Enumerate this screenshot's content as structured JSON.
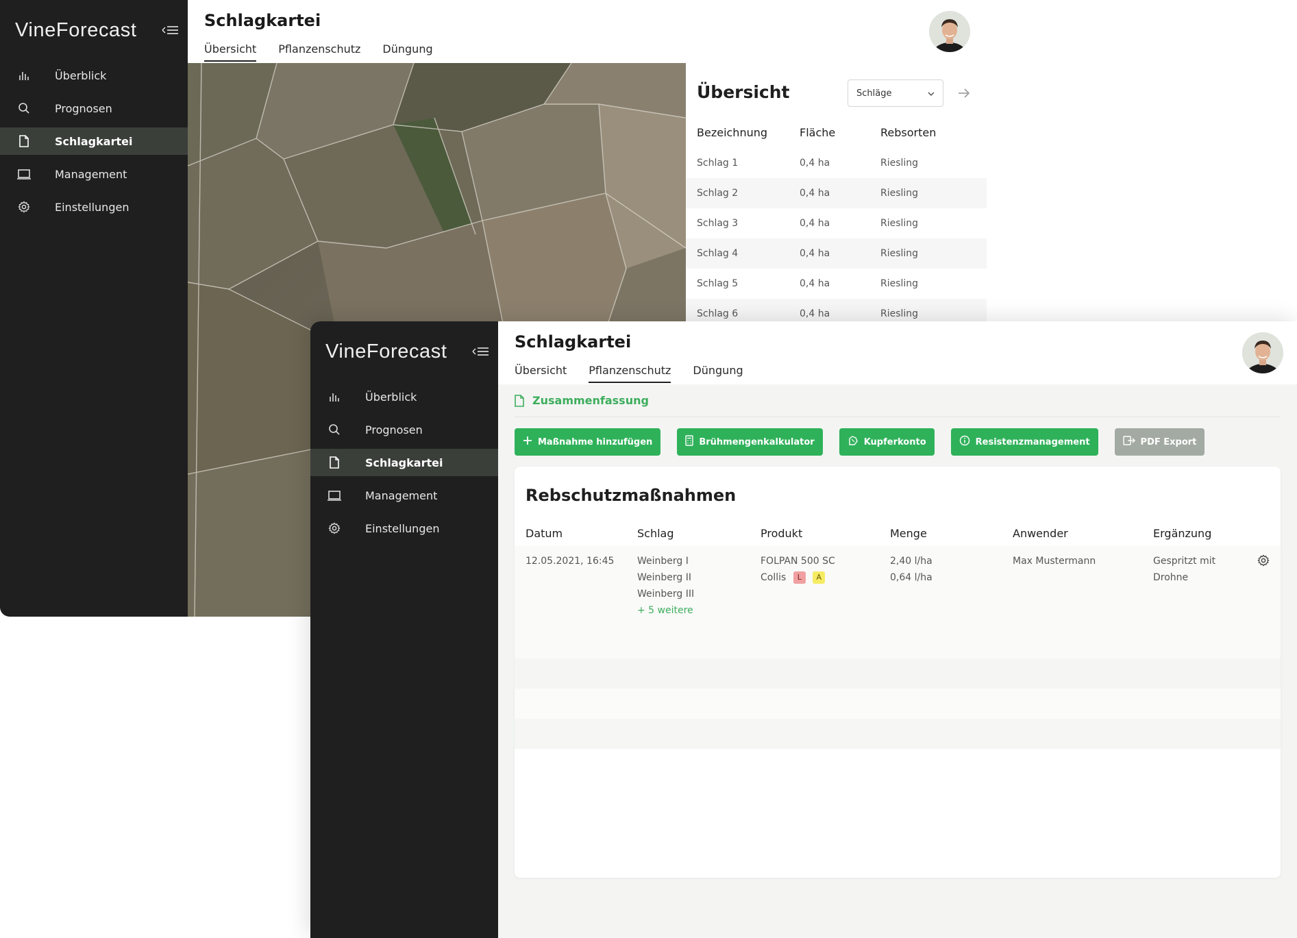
{
  "brand": {
    "name": "VineForecast"
  },
  "colors": {
    "sidebar": "#1f1f1f",
    "accent": "#2fb15a",
    "active_nav": "#3b3f3a",
    "chip_l": "#f0a0a0",
    "chip_a": "#f6ec64"
  },
  "nav": [
    {
      "label": "Überblick",
      "icon": "bar-chart-icon"
    },
    {
      "label": "Prognosen",
      "icon": "search-icon"
    },
    {
      "label": "Schlagkartei",
      "icon": "document-icon",
      "active": true
    },
    {
      "label": "Management",
      "icon": "laptop-icon"
    },
    {
      "label": "Einstellungen",
      "icon": "gear-icon"
    }
  ],
  "page": {
    "title": "Schlagkartei"
  },
  "tabs": [
    "Übersicht",
    "Pflanzenschutz",
    "Düngung"
  ],
  "back_window": {
    "active_tab": "Übersicht",
    "panel": {
      "title": "Übersicht",
      "select_value": "Schläge",
      "columns": [
        "Bezeichnung",
        "Fläche",
        "Rebsorten"
      ],
      "rows": [
        [
          "Schlag 1",
          "0,4 ha",
          "Riesling"
        ],
        [
          "Schlag 2",
          "0,4 ha",
          "Riesling"
        ],
        [
          "Schlag 3",
          "0,4 ha",
          "Riesling"
        ],
        [
          "Schlag 4",
          "0,4 ha",
          "Riesling"
        ],
        [
          "Schlag 5",
          "0,4 ha",
          "Riesling"
        ],
        [
          "Schlag 6",
          "0,4 ha",
          "Riesling"
        ]
      ]
    }
  },
  "front_window": {
    "active_tab": "Pflanzenschutz",
    "summary_label": "Zusammenfassung",
    "actions": [
      {
        "label": "Maßnahme hinzufügen",
        "icon": "plus-icon"
      },
      {
        "label": "Brühmengenkalkulator",
        "icon": "calculator-icon"
      },
      {
        "label": "Kupferkonto",
        "icon": "copper-icon"
      },
      {
        "label": "Resistenzmanagement",
        "icon": "info-icon"
      },
      {
        "label": "PDF Export",
        "icon": "export-icon",
        "disabled": true
      }
    ],
    "card": {
      "title": "Rebschutzmaßnahmen",
      "columns": [
        "Datum",
        "Schlag",
        "Produkt",
        "Menge",
        "Anwender",
        "Ergänzung"
      ],
      "entry": {
        "datum": "12.05.2021, 16:45",
        "schlag": [
          "Weinberg I",
          "Weinberg II",
          "Weinberg III"
        ],
        "schlag_more": "+ 5 weitere",
        "produkt": [
          "FOLPAN 500 SC",
          "Collis"
        ],
        "chips": [
          "L",
          "A"
        ],
        "menge": [
          "2,40 l/ha",
          "0,64 l/ha"
        ],
        "anwender": "Max Mustermann",
        "ergaenzung": [
          "Gespritzt mit",
          "Drohne"
        ]
      }
    }
  }
}
